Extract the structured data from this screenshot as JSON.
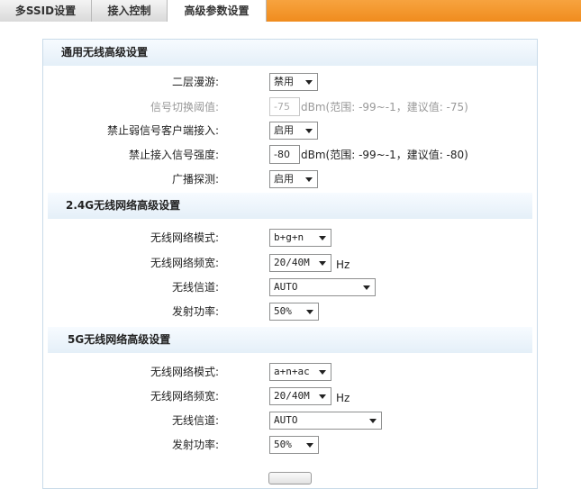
{
  "tabs": [
    {
      "label": "多SSID设置"
    },
    {
      "label": "接入控制"
    },
    {
      "label": "高级参数设置"
    }
  ],
  "general": {
    "title": "通用无线高级设置",
    "roaming_label": "二层漫游:",
    "roaming_value": "禁用",
    "switch_threshold_label": "信号切换阈值:",
    "switch_threshold_value": "-75",
    "switch_threshold_hint": "dBm(范围: -99~-1，建议值: -75)",
    "weak_block_label": "禁止弱信号客户端接入:",
    "weak_block_value": "启用",
    "block_strength_label": "禁止接入信号强度:",
    "block_strength_value": "-80",
    "block_strength_hint": "dBm(范围: -99~-1，建议值: -80)",
    "broadcast_probe_label": "广播探测:",
    "broadcast_probe_value": "启用"
  },
  "band24": {
    "title": "2.4G无线网络高级设置",
    "mode_label": "无线网络模式:",
    "mode_value": "b+g+n",
    "bandwidth_label": "无线网络频宽:",
    "bandwidth_value": "20/40M",
    "bandwidth_unit": "Hz",
    "channel_label": "无线信道:",
    "channel_value": "AUTO",
    "power_label": "发射功率:",
    "power_value": "50%"
  },
  "band5": {
    "title": "5G无线网络高级设置",
    "mode_label": "无线网络模式:",
    "mode_value": "a+n+ac",
    "bandwidth_label": "无线网络频宽:",
    "bandwidth_value": "20/40M",
    "bandwidth_unit": "Hz",
    "channel_label": "无线信道:",
    "channel_value": "AUTO",
    "power_label": "发射功率:",
    "power_value": "50%"
  }
}
